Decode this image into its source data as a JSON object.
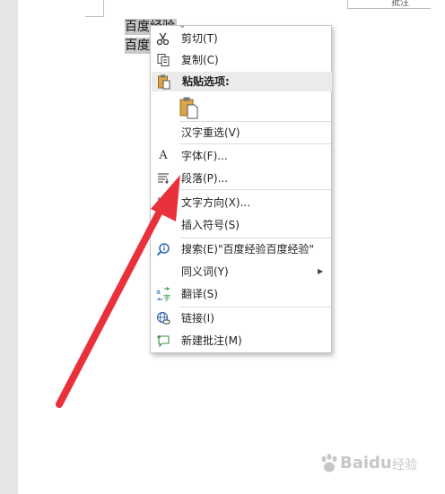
{
  "document": {
    "selected_lines": [
      "百度经验",
      "百度"
    ],
    "top_box_text": "批注"
  },
  "menu": {
    "items": [
      {
        "id": "cut",
        "label": "剪切(T)"
      },
      {
        "id": "copy",
        "label": "复制(C)"
      },
      {
        "id": "paste_header",
        "label": "粘贴选项:"
      },
      {
        "id": "hanzi",
        "label": "汉字重选(V)"
      },
      {
        "id": "font",
        "label": "字体(F)..."
      },
      {
        "id": "paragraph",
        "label": "段落(P)..."
      },
      {
        "id": "text_direction",
        "label": "文字方向(X)..."
      },
      {
        "id": "insert_symbol",
        "label": "插入符号(S)"
      },
      {
        "id": "search",
        "label": "搜索(E)\"百度经验百度经验\""
      },
      {
        "id": "synonyms",
        "label": "同义词(Y)"
      },
      {
        "id": "translate",
        "label": "翻译(S)"
      },
      {
        "id": "link",
        "label": "链接(I)"
      },
      {
        "id": "new_comment",
        "label": "新建批注(M)"
      }
    ]
  },
  "watermark": {
    "brand": "Baidu",
    "sub": "经验"
  },
  "colors": {
    "accent_arrow": "#e8313a",
    "selection": "#c8c8c8",
    "menu_header": "#ebebeb"
  }
}
